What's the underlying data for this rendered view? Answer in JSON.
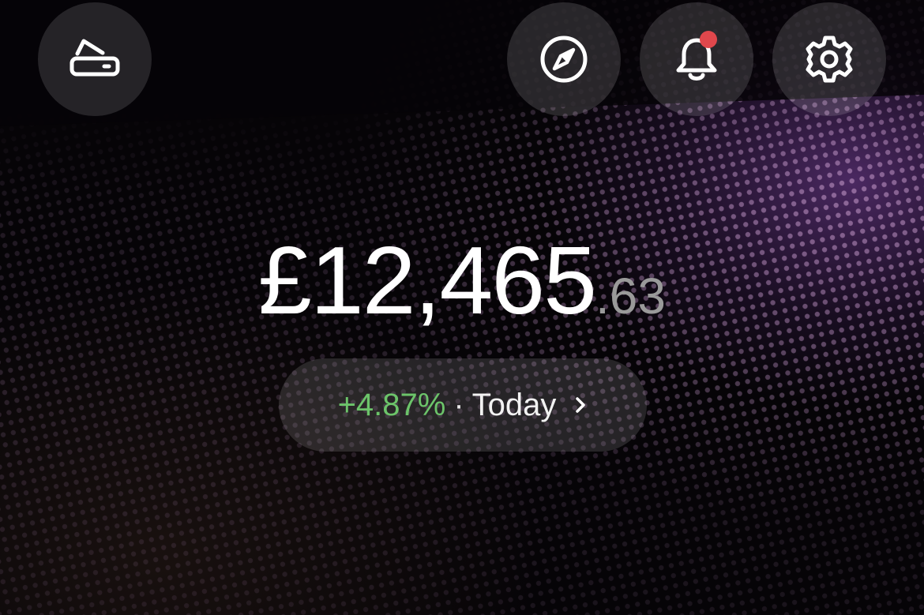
{
  "header": {
    "left_button": {
      "icon": "card-tilt-icon"
    },
    "right_buttons": [
      {
        "icon": "compass-icon"
      },
      {
        "icon": "bell-icon",
        "has_notification": true
      },
      {
        "icon": "gear-icon"
      }
    ]
  },
  "balance": {
    "currency_symbol": "£",
    "whole": "12,465",
    "decimal": ".63"
  },
  "change": {
    "percent": "+4.87%",
    "separator": "·",
    "period": "Today",
    "chevron_icon": "chevron-right-icon"
  },
  "colors": {
    "background": "#060407",
    "accent_glow": "#8246aa",
    "positive": "#6cc46a",
    "notification": "#e0474c",
    "muted_text": "#9a9a9a"
  }
}
